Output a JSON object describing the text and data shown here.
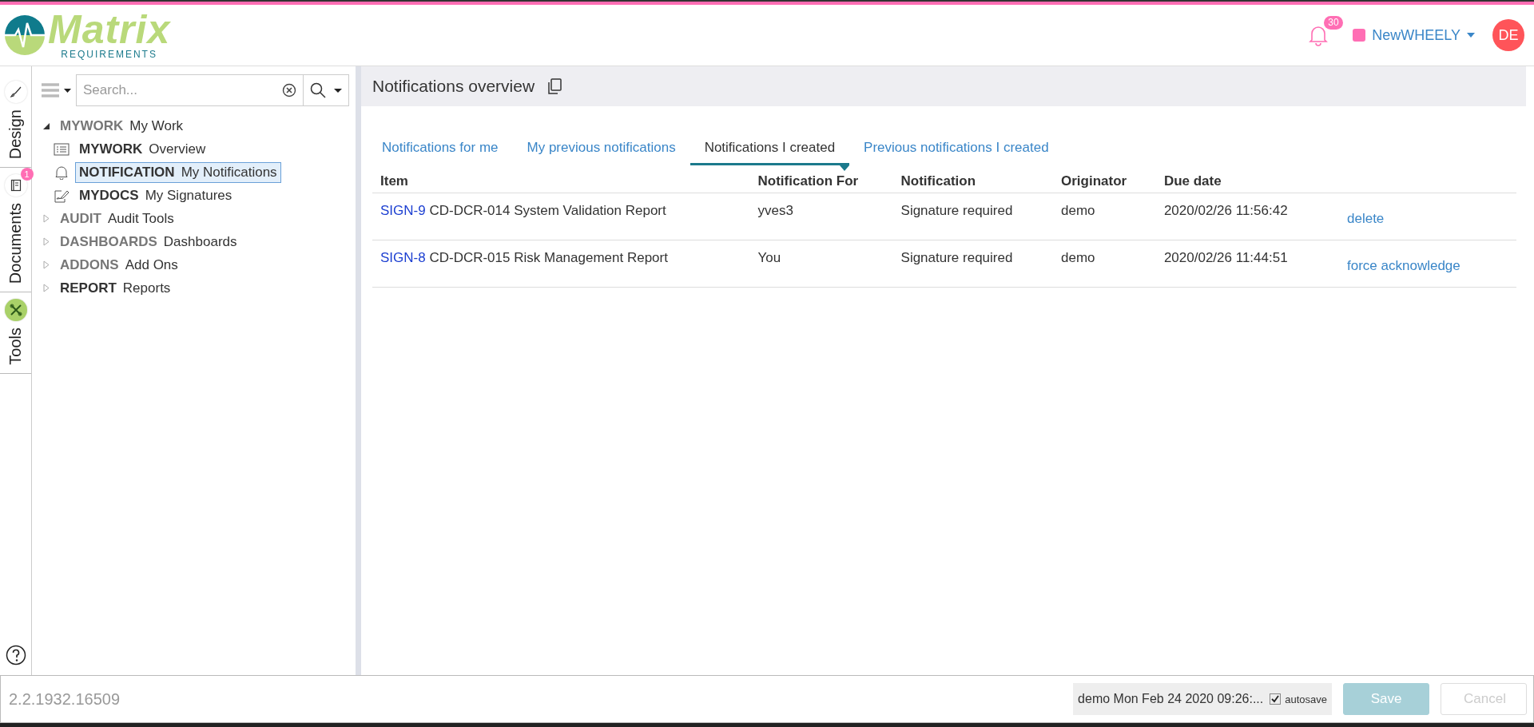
{
  "header": {
    "logo": {
      "name": "Matrix",
      "tagline": "REQUIREMENTS"
    },
    "notification_count": "30",
    "project": {
      "name": "NewWHEELY",
      "color": "#ff6eb4"
    },
    "user": {
      "initials": "DE"
    }
  },
  "side_tabs": [
    {
      "label": "Design"
    },
    {
      "label": "Documents",
      "badge": "1"
    },
    {
      "label": "Tools"
    }
  ],
  "search": {
    "placeholder": "Search..."
  },
  "tree": [
    {
      "code": "MYWORK",
      "label": "My Work",
      "expanded": true,
      "muted": true,
      "selected": false,
      "children": [
        {
          "code": "MYWORK",
          "label": "Overview",
          "selected": false
        },
        {
          "code": "NOTIFICATION",
          "label": "My Notifications",
          "selected": true
        },
        {
          "code": "MYDOCS",
          "label": "My Signatures",
          "selected": false
        }
      ]
    },
    {
      "code": "AUDIT",
      "label": "Audit Tools",
      "expanded": false,
      "muted": true,
      "selected": false
    },
    {
      "code": "DASHBOARDS",
      "label": "Dashboards",
      "expanded": false,
      "muted": true,
      "selected": false
    },
    {
      "code": "ADDONS",
      "label": "Add Ons",
      "expanded": false,
      "muted": true,
      "selected": false
    },
    {
      "code": "REPORT",
      "label": "Reports",
      "expanded": false,
      "muted": false,
      "selected": false
    }
  ],
  "main": {
    "title": "Notifications overview",
    "tabs": [
      {
        "label": "Notifications for me",
        "selected": false
      },
      {
        "label": "My previous notifications",
        "selected": false
      },
      {
        "label": "Notifications I created",
        "selected": true
      },
      {
        "label": "Previous notifications I created",
        "selected": false
      }
    ],
    "table": {
      "columns": [
        "Item",
        "Notification For",
        "Notification",
        "Originator",
        "Due date"
      ],
      "rows": [
        {
          "item_id": "SIGN-9",
          "item_title": "CD-DCR-014 System Validation Report",
          "notification_for": "yves3",
          "notification": "Signature required",
          "originator": "demo",
          "due_date": "2020/02/26 11:56:42",
          "action": "delete"
        },
        {
          "item_id": "SIGN-8",
          "item_title": "CD-DCR-015 Risk Management Report",
          "notification_for": "You",
          "notification": "Signature required",
          "originator": "demo",
          "due_date": "2020/02/26 11:44:51",
          "action": "force acknowledge"
        }
      ]
    }
  },
  "footer": {
    "version": "2.2.1932.16509",
    "status": "demo Mon Feb 24 2020 09:26:...",
    "autosave": {
      "label": "autosave",
      "checked": true
    },
    "buttons": [
      {
        "label": "Save",
        "kind": "primary",
        "disabled": false
      },
      {
        "label": "Cancel",
        "kind": "secondary",
        "disabled": true
      }
    ]
  }
}
